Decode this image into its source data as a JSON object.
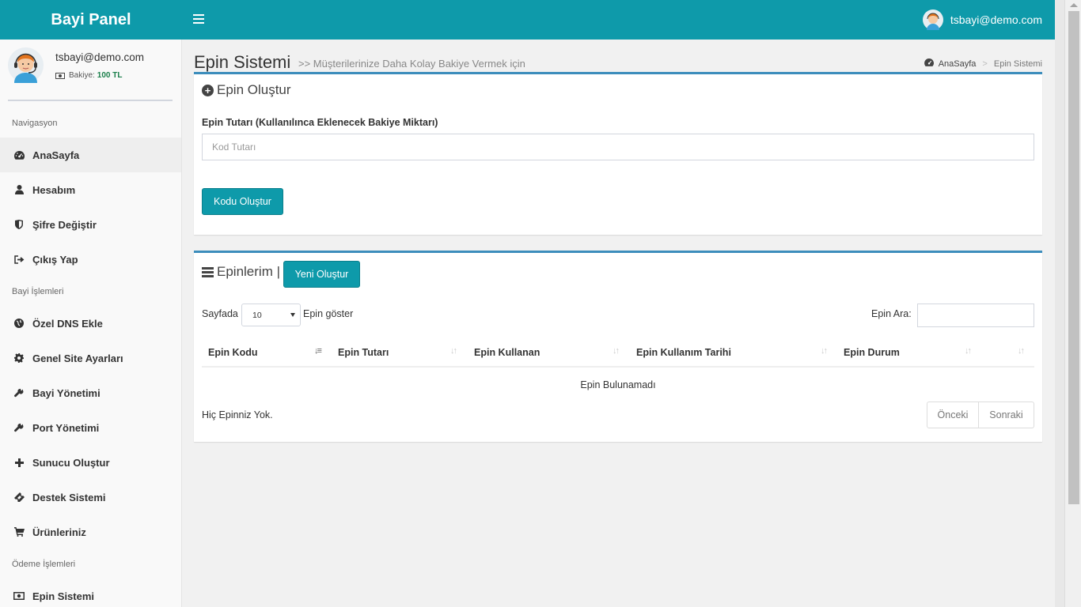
{
  "topbar": {
    "brand": "Bayi Panel",
    "user_email": "tsbayi@demo.com"
  },
  "sidebar": {
    "profile": {
      "name": "tsbayi@demo.com",
      "balance_label": "Bakiye:",
      "balance_value": "100 TL"
    },
    "sections": [
      {
        "header": "Navigasyon"
      },
      {
        "header": "Bayi İşlemleri"
      },
      {
        "header": "Ödeme İşlemleri"
      }
    ],
    "items": [
      {
        "label": "AnaSayfa",
        "icon": "dashboard-icon"
      },
      {
        "label": "Hesabım",
        "icon": "user-icon"
      },
      {
        "label": "Şifre Değiştir",
        "icon": "shield-icon"
      },
      {
        "label": "Çıkış Yap",
        "icon": "sign-out-icon"
      },
      {
        "label": "Özel DNS Ekle",
        "icon": "globe-icon"
      },
      {
        "label": "Genel Site Ayarları",
        "icon": "gear-icon"
      },
      {
        "label": "Bayi Yönetimi",
        "icon": "wrench-icon"
      },
      {
        "label": "Port Yönetimi",
        "icon": "wrench-icon"
      },
      {
        "label": "Sunucu Oluştur",
        "icon": "plus-icon"
      },
      {
        "label": "Destek Sistemi",
        "icon": "ticket-icon"
      },
      {
        "label": "Ürünleriniz",
        "icon": "cart-icon"
      },
      {
        "label": "Epin Sistemi",
        "icon": "money-icon"
      }
    ]
  },
  "page": {
    "title": "Epin Sistemi",
    "subtitle": ">> Müşterilerinize Daha Kolay Bakiye Vermek için",
    "breadcrumb": {
      "home": "AnaSayfa",
      "current": "Epin Sistemi"
    }
  },
  "create_box": {
    "title": "Epin Oluştur",
    "field_label": "Epin Tutarı (Kullanılınca Eklenecek Bakiye Miktarı)",
    "input_placeholder": "Kod Tutarı",
    "button_label": "Kodu Oluştur"
  },
  "list_box": {
    "title": "Epinlerim |",
    "new_button_label": "Yeni Oluştur",
    "length_label_before": "Sayfada",
    "length_value": "10",
    "length_label_after": "Epin göster",
    "search_label": "Epin Ara:",
    "columns": [
      "Epin Kodu",
      "Epin Tutarı",
      "Epin Kullanan",
      "Epin Kullanım Tarihi",
      "Epin Durum",
      ""
    ],
    "empty_message": "Epin Bulunamadı",
    "info": "Hiç Epinniz Yok.",
    "pager": {
      "prev": "Önceki",
      "next": "Sonraki"
    }
  }
}
